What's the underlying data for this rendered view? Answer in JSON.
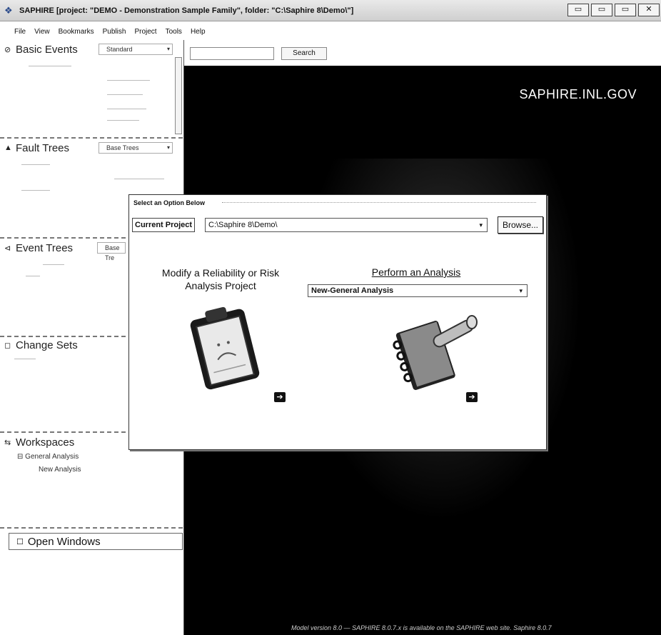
{
  "window": {
    "title": "SAPHIRE [project: \"DEMO - Demonstration Sample Family\", folder: \"C:\\Saphire 8\\Demo\\\"]",
    "controls": [
      "▭",
      "▭",
      "▭",
      "✕"
    ]
  },
  "menu": {
    "items": [
      "File",
      "View",
      "Bookmarks",
      "Publish",
      "Project",
      "Tools",
      "Help"
    ]
  },
  "sidebar": {
    "basic_events": {
      "title": "Basic Events",
      "select": "Standard"
    },
    "fault_trees": {
      "title": "Fault Trees",
      "select": "Base Trees"
    },
    "event_trees": {
      "title": "Event Trees",
      "select": "Base Tre"
    },
    "change_sets": {
      "title": "Change Sets"
    },
    "workspaces": {
      "title": "Workspaces",
      "items": [
        "General Analysis",
        "New Analysis"
      ]
    },
    "open_windows": {
      "title": "Open Windows"
    }
  },
  "search": {
    "button_label": "Search",
    "value": ""
  },
  "main": {
    "site_label": "SAPHIRE.INL.GOV",
    "status_text": "Model version 8.0 — SAPHIRE 8.0.7.x is available on the SAPHIRE web site.  Saphire 8.0.7"
  },
  "dialog": {
    "title": "Select an Option Below",
    "current_project_label": "Current Project",
    "current_project_value": "C:\\Saphire 8\\Demo\\",
    "browse_label": "Browse...",
    "modify_label": "Modify a Reliability or Risk Analysis Project",
    "perform_label": "Perform an Analysis",
    "analysis_select_value": "New-General Analysis",
    "arrow_glyph": "➔"
  },
  "colors": {
    "background_main": "#000000",
    "dialog_bg": "#ffffff",
    "site_label": "#ffffff"
  }
}
